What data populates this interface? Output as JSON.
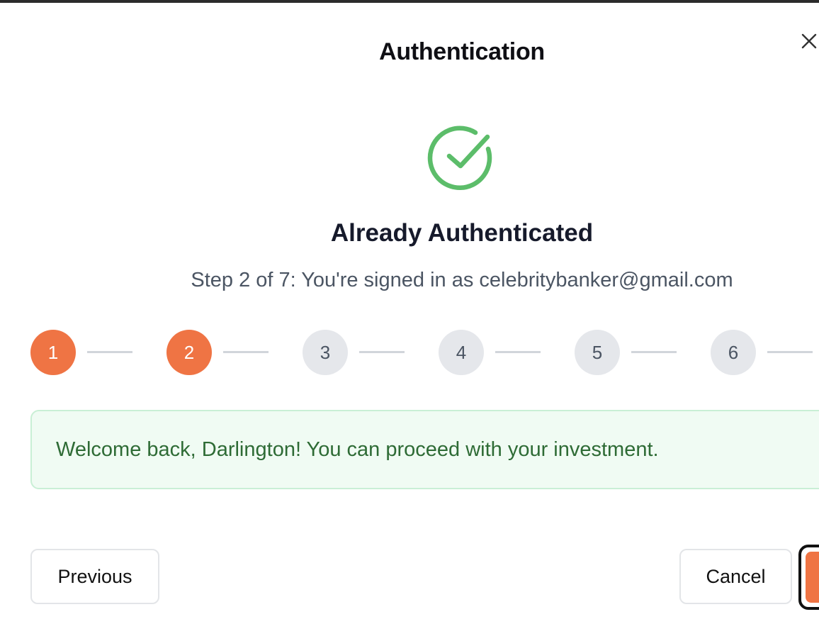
{
  "dialog": {
    "title": "Authentication",
    "close_icon": "close-icon"
  },
  "status": {
    "icon": "check-circle-icon",
    "icon_color": "#5cbd6a",
    "heading": "Already Authenticated",
    "description": "Step 2 of 7: You're signed in as celebritybanker@gmail.com"
  },
  "stepper": {
    "current_step": 2,
    "total_steps": 7,
    "steps": [
      {
        "label": "1",
        "state": "completed"
      },
      {
        "label": "2",
        "state": "active"
      },
      {
        "label": "3",
        "state": "pending"
      },
      {
        "label": "4",
        "state": "pending"
      },
      {
        "label": "5",
        "state": "pending"
      },
      {
        "label": "6",
        "state": "pending"
      }
    ],
    "active_color": "#ef7444",
    "inactive_color": "#e5e7eb"
  },
  "alert": {
    "message": "Welcome back, Darlington! You can proceed with your investment.",
    "text_color": "#2e6b35",
    "background": "#f0fbf3"
  },
  "footer": {
    "previous_label": "Previous",
    "cancel_label": "Cancel",
    "next_color": "#ef7444"
  }
}
